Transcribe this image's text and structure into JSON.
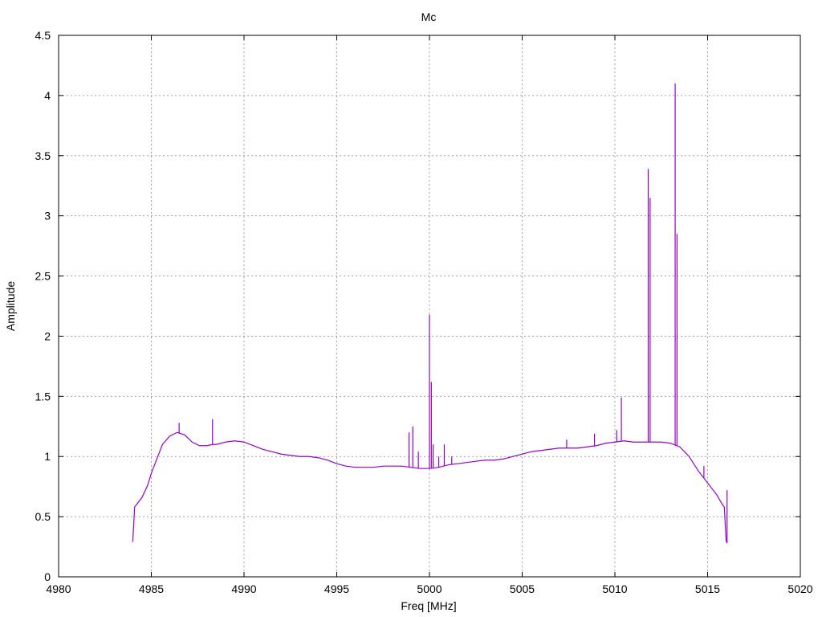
{
  "chart_data": {
    "type": "line",
    "title": "Mc",
    "xlabel": "Freq [MHz]",
    "ylabel": "Amplitude",
    "xlim": [
      4980,
      5020
    ],
    "ylim": [
      0,
      4.5
    ],
    "xticks": [
      4980,
      4985,
      4990,
      4995,
      5000,
      5005,
      5010,
      5015,
      5020
    ],
    "xtick_labels": [
      "4980",
      "4985",
      "4990",
      "4995",
      "5000",
      "5005",
      "5010",
      "5015",
      "5020"
    ],
    "yticks": [
      0,
      0.5,
      1,
      1.5,
      2,
      2.5,
      3,
      3.5,
      4,
      4.5
    ],
    "ytick_labels": [
      "0",
      "0.5",
      "1",
      "1.5",
      "2",
      "2.5",
      "3",
      "3.5",
      "4",
      "4.5"
    ],
    "grid": true,
    "line_color": "#9400d3",
    "series": [
      {
        "x": [
          4984.0,
          4984.1,
          4984.2,
          4984.3,
          4984.5,
          4984.8,
          4985.0,
          4985.3,
          4985.6,
          4986.0,
          4986.4,
          4986.8,
          4987.2,
          4987.6,
          4988.0,
          4988.3,
          4988.5,
          4989.0,
          4989.5,
          4990.0,
          4990.5,
          4991.0,
          4991.5,
          4992.0,
          4992.5,
          4993.0,
          4993.5,
          4994.0,
          4994.5,
          4995.0,
          4995.5,
          4996.0,
          4996.5,
          4997.0,
          4997.5,
          4998.0,
          4998.5,
          4999.0,
          4999.5,
          5000.0,
          5000.5,
          5001.0,
          5001.5,
          5002.0,
          5002.5,
          5003.0,
          5003.5,
          5004.0,
          5004.5,
          5005.0,
          5005.5,
          5006.0,
          5006.5,
          5007.0,
          5007.5,
          5008.0,
          5008.5,
          5009.0,
          5009.5,
          5010.0,
          5010.5,
          5011.0,
          5011.5,
          5012.0,
          5012.5,
          5013.0,
          5013.5,
          5014.0,
          5014.5,
          5015.0,
          5015.5,
          5015.8,
          5015.9,
          5016.0,
          5016.05
        ],
        "y": [
          0.29,
          0.58,
          0.6,
          0.62,
          0.66,
          0.76,
          0.86,
          0.98,
          1.1,
          1.17,
          1.2,
          1.18,
          1.12,
          1.09,
          1.09,
          1.1,
          1.1,
          1.12,
          1.13,
          1.12,
          1.09,
          1.06,
          1.04,
          1.02,
          1.01,
          1.0,
          1.0,
          0.99,
          0.97,
          0.94,
          0.92,
          0.91,
          0.91,
          0.91,
          0.92,
          0.92,
          0.92,
          0.91,
          0.9,
          0.9,
          0.91,
          0.93,
          0.94,
          0.95,
          0.96,
          0.97,
          0.97,
          0.98,
          1.0,
          1.02,
          1.04,
          1.05,
          1.06,
          1.07,
          1.07,
          1.07,
          1.08,
          1.09,
          1.11,
          1.12,
          1.13,
          1.12,
          1.12,
          1.12,
          1.12,
          1.11,
          1.08,
          1.0,
          0.88,
          0.78,
          0.68,
          0.6,
          0.58,
          0.3,
          0.28
        ]
      }
    ],
    "spikes": [
      {
        "x": 4986.5,
        "y": 1.28
      },
      {
        "x": 4988.3,
        "y": 1.31
      },
      {
        "x": 4998.9,
        "y": 1.2
      },
      {
        "x": 4999.1,
        "y": 1.25
      },
      {
        "x": 4999.4,
        "y": 1.04
      },
      {
        "x": 5000.0,
        "y": 2.18
      },
      {
        "x": 5000.1,
        "y": 1.62
      },
      {
        "x": 5000.2,
        "y": 1.1
      },
      {
        "x": 5000.5,
        "y": 1.0
      },
      {
        "x": 5000.8,
        "y": 1.1
      },
      {
        "x": 5001.2,
        "y": 1.0
      },
      {
        "x": 5007.4,
        "y": 1.14
      },
      {
        "x": 5008.9,
        "y": 1.19
      },
      {
        "x": 5010.1,
        "y": 1.22
      },
      {
        "x": 5010.35,
        "y": 1.49
      },
      {
        "x": 5011.8,
        "y": 3.39
      },
      {
        "x": 5011.9,
        "y": 3.15
      },
      {
        "x": 5013.25,
        "y": 4.1
      },
      {
        "x": 5013.35,
        "y": 2.85
      },
      {
        "x": 5014.8,
        "y": 0.92
      },
      {
        "x": 5016.05,
        "y": 0.72
      }
    ]
  }
}
